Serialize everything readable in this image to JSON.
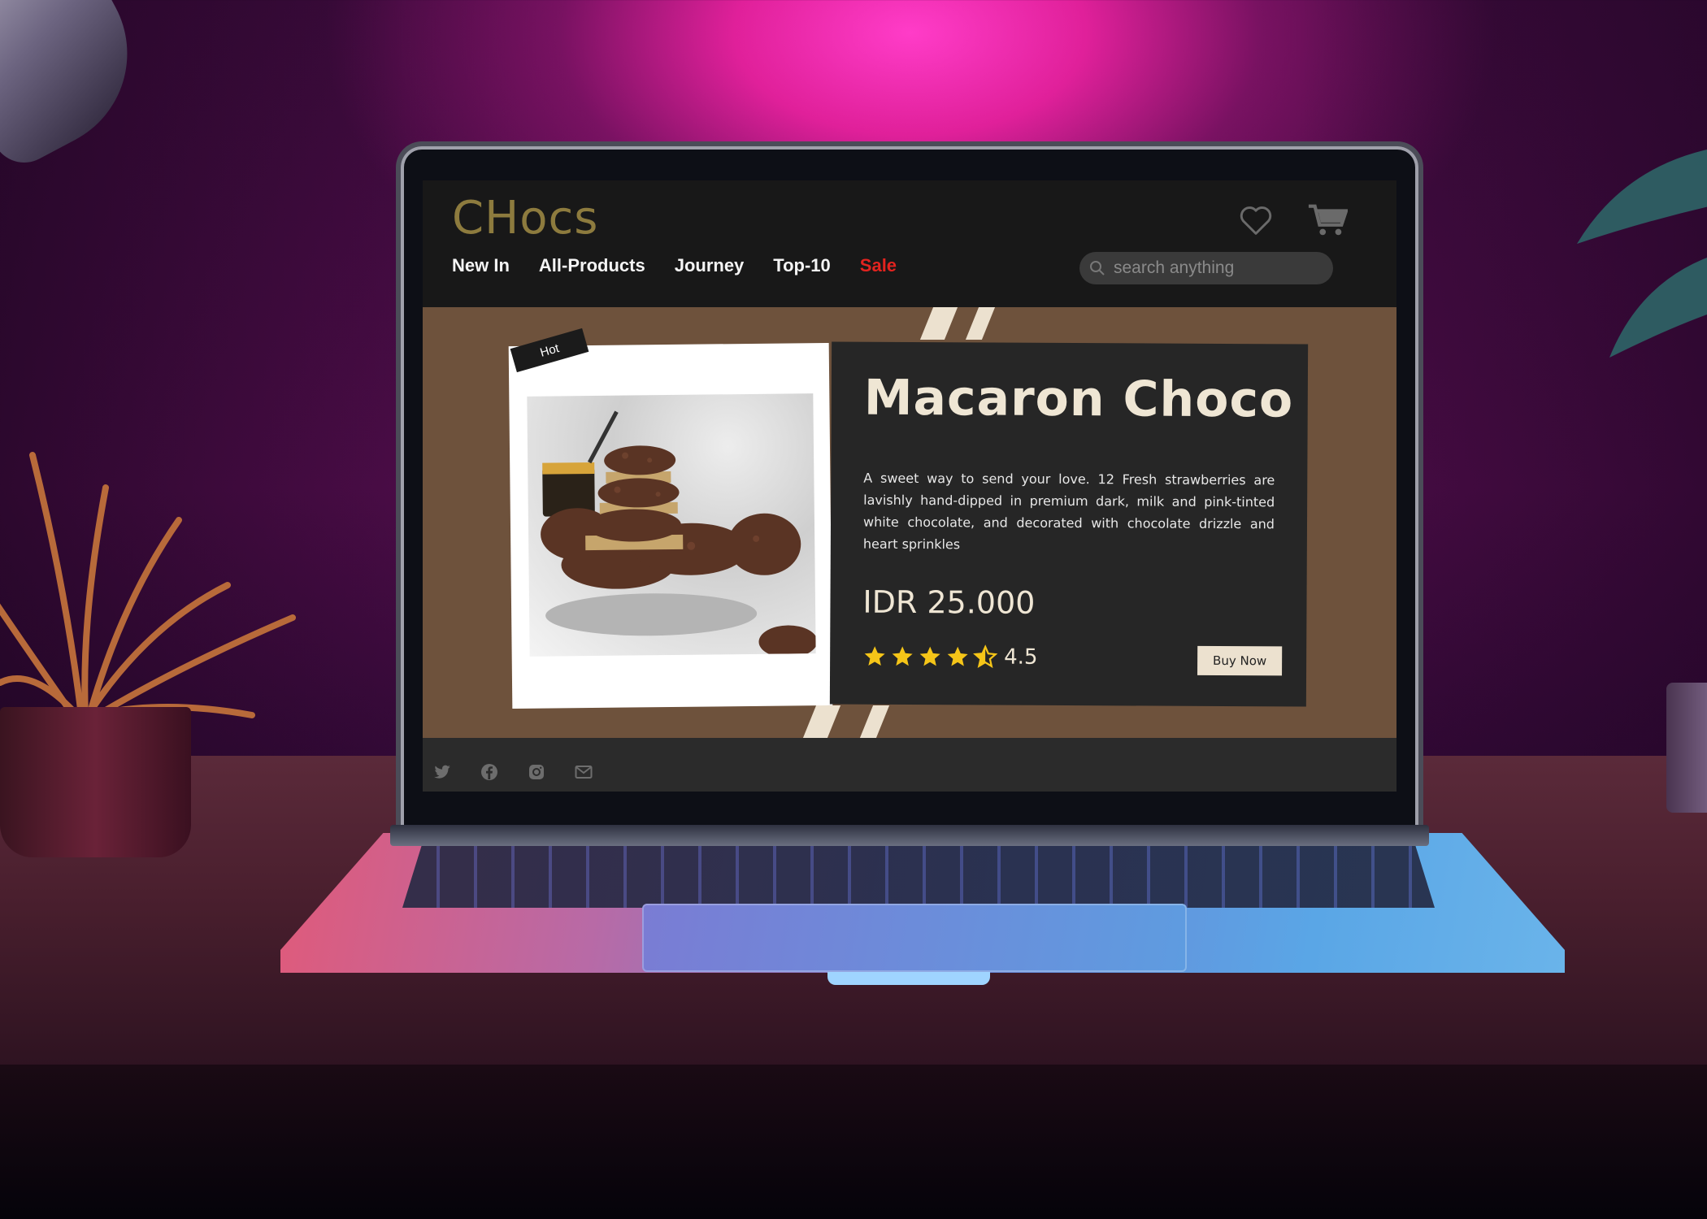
{
  "site": {
    "logo": "CHocs"
  },
  "nav": {
    "items": [
      {
        "label": "New In"
      },
      {
        "label": "All-Products"
      },
      {
        "label": "Journey"
      },
      {
        "label": "Top-10"
      },
      {
        "label": "Sale"
      }
    ]
  },
  "header": {
    "icons": [
      "heart-icon",
      "cart-icon"
    ],
    "search": {
      "placeholder": "search anything",
      "value": ""
    }
  },
  "product": {
    "badge": "Hot",
    "title": "Macaron Choco",
    "description": "A sweet way to send your love. 12 Fresh strawberries are lavishly hand-dipped in premium dark, milk and pink-tinted white chocolate, and decorated with chocolate drizzle and heart sprinkles",
    "price": "IDR 25.000",
    "rating": {
      "value": "4.5",
      "stars": 4.5,
      "max": 5
    },
    "buy_label": "Buy Now"
  },
  "footer": {
    "social_icons": [
      "twitter-icon",
      "facebook-icon",
      "instagram-icon",
      "mail-icon"
    ]
  },
  "colors": {
    "logo": "#8d7b3e",
    "sale": "#e3231f",
    "hero_bg": "#6e523c",
    "card_dark": "#262626",
    "accent_cream": "#ece1cf",
    "star": "#f5c518"
  }
}
